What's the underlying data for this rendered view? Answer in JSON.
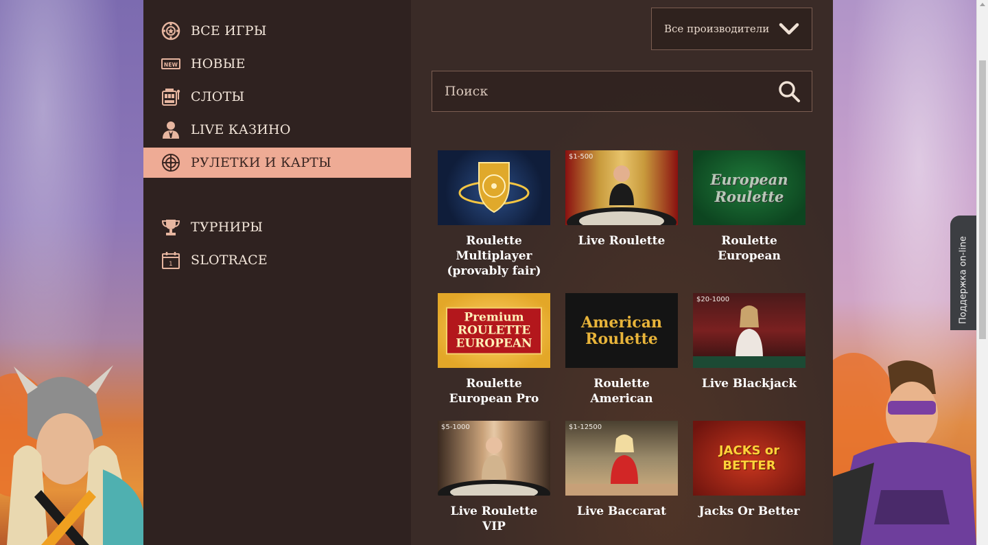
{
  "sidebar": {
    "items": [
      {
        "label": "ВСЕ ИГРЫ",
        "icon": "chip-icon",
        "active": false
      },
      {
        "label": "НОВЫЕ",
        "icon": "new-badge-icon",
        "active": false
      },
      {
        "label": "СЛОТЫ",
        "icon": "slot-machine-icon",
        "active": false
      },
      {
        "label": "LIVE КАЗИНО",
        "icon": "dealer-icon",
        "active": false
      },
      {
        "label": "РУЛЕТКИ И КАРТЫ",
        "icon": "roulette-icon",
        "active": true
      },
      {
        "label": "ТУРНИРЫ",
        "icon": "trophy-icon",
        "active": false
      },
      {
        "label": "SLOTRACE",
        "icon": "calendar-icon",
        "active": false
      }
    ],
    "calendar_day": "1",
    "new_badge_text": "NEW"
  },
  "filters": {
    "provider_selected": "Все производители",
    "search_placeholder": "Поиск"
  },
  "games": [
    {
      "name": "Roulette Multiplayer (provably fair)",
      "limit": "",
      "art": ""
    },
    {
      "name": "Live Roulette",
      "limit": "$1-500",
      "art": ""
    },
    {
      "name": "Roulette European",
      "limit": "",
      "art": "European Roulette"
    },
    {
      "name": "Roulette European Pro",
      "limit": "",
      "art": "Premium ROULETTE EUROPEAN"
    },
    {
      "name": "Roulette American",
      "limit": "",
      "art": "American Roulette"
    },
    {
      "name": "Live Blackjack",
      "limit": "$20-1000",
      "art": ""
    },
    {
      "name": "Live Roulette VIP",
      "limit": "$5-1000",
      "art": ""
    },
    {
      "name": "Live Baccarat",
      "limit": "$1-12500",
      "art": ""
    },
    {
      "name": "Jacks Or Better",
      "limit": "",
      "art": "JACKS or BETTER"
    }
  ],
  "support": {
    "label": "Поддержка on-line"
  },
  "colors": {
    "sidebar_bg": "#2f2220",
    "active_item_bg": "#eeab95",
    "main_bg": "#3a2b27",
    "text_light": "#f3e6da",
    "border": "#7c5e52",
    "support_green": "#43b04a"
  }
}
